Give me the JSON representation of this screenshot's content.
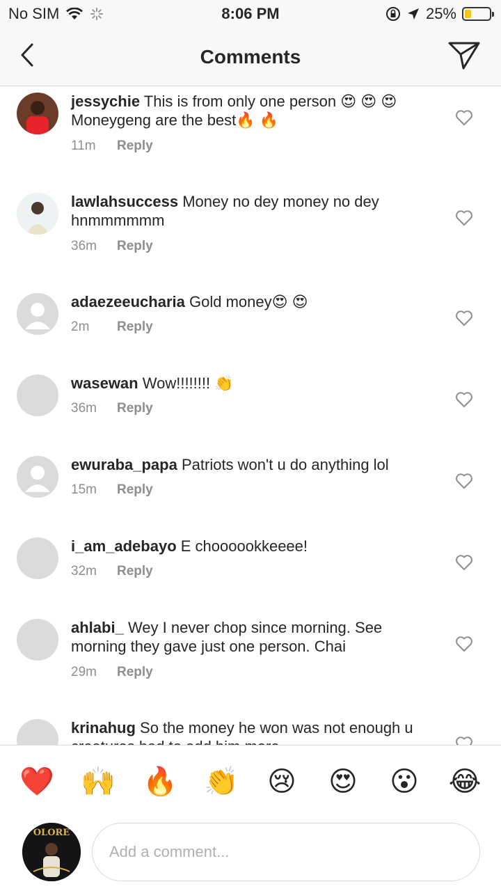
{
  "status_bar": {
    "carrier": "No SIM",
    "time": "8:06 PM",
    "battery_text": "25%",
    "battery_level": 0.25,
    "battery_color": "#f5c518"
  },
  "nav": {
    "title": "Comments",
    "back_icon": "chevron-left-icon",
    "share_icon": "paper-plane-icon"
  },
  "comments": [
    {
      "username": "jessychie",
      "text": "This is from only one person 😍 😍 😍Moneygeng are the best🔥 🔥",
      "time": "11m",
      "reply": "Reply",
      "avatar": "photo"
    },
    {
      "username": "lawlahsuccess",
      "text": "Money no dey money no dey hnmmmmmm",
      "time": "36m",
      "reply": "Reply",
      "avatar": "photo"
    },
    {
      "username": "adaezeeucharia",
      "text": "Gold money😍 😍",
      "time": "2m",
      "reply": "Reply",
      "avatar": "default"
    },
    {
      "username": "wasewan",
      "text": "Wow!!!!!!!! 👏",
      "time": "36m",
      "reply": "Reply",
      "avatar": "blank"
    },
    {
      "username": "ewuraba_papa",
      "text": "Patriots won't u do anything lol",
      "time": "15m",
      "reply": "Reply",
      "avatar": "default"
    },
    {
      "username": "i_am_adebayo",
      "text": "E choooookkeeee!",
      "time": "32m",
      "reply": "Reply",
      "avatar": "blank"
    },
    {
      "username": "ahlabi_",
      "text": "Wey I never chop since morning. See morning they gave just one person. Chai",
      "time": "29m",
      "reply": "Reply",
      "avatar": "blank"
    },
    {
      "username": "krinahug",
      "text": "So the money he won was not enough u creatures had to add him more",
      "time": "",
      "reply": "",
      "avatar": "blank"
    }
  ],
  "emoji_bar": [
    "❤️",
    "🙌",
    "🔥",
    "👏",
    "😢",
    "😍",
    "😮",
    "😂"
  ],
  "input": {
    "placeholder": "Add a comment...",
    "avatar_text": "OLORE"
  }
}
